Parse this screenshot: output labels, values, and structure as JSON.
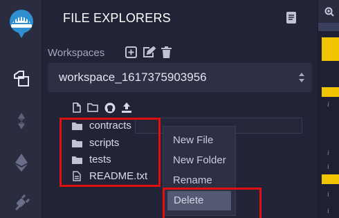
{
  "rail": {
    "items": [
      {
        "icon": "remix-logo-icon"
      },
      {
        "icon": "file-explorer-icon",
        "active": true
      },
      {
        "icon": "solidity-compiler-icon"
      },
      {
        "icon": "deploy-run-icon"
      },
      {
        "icon": "plugin-manager-icon"
      }
    ]
  },
  "panel": {
    "title": "FILE EXPLORERS",
    "workspaces_label": "Workspaces",
    "workspace_selected": "workspace_1617375903956"
  },
  "tree": {
    "items": [
      {
        "label": "contracts",
        "type": "folder"
      },
      {
        "label": "scripts",
        "type": "folder"
      },
      {
        "label": "tests",
        "type": "folder"
      },
      {
        "label": "README.txt",
        "type": "file"
      }
    ]
  },
  "context_menu": {
    "items": [
      {
        "label": "New File"
      },
      {
        "label": "New Folder"
      },
      {
        "label": "Rename"
      },
      {
        "label": "Delete",
        "hovered": true
      }
    ]
  },
  "right_strip": {
    "info_marker": "i"
  },
  "colors": {
    "accent_highlight": "#f3c500",
    "annotation_red": "#e01010",
    "logo_blue": "#2f8fd0"
  }
}
